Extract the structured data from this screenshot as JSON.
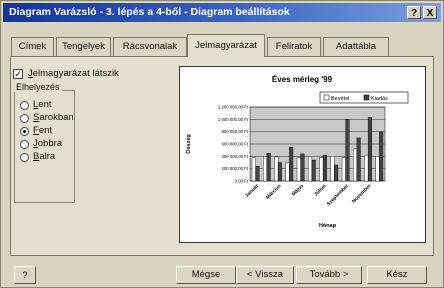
{
  "window": {
    "title": "Diagram Varázsló - 3. lépés a 4-ből - Diagram beállítások",
    "help_glyph": "?",
    "close_glyph": "X"
  },
  "tabs": [
    {
      "label": "Címek",
      "active": false
    },
    {
      "label": "Tengelyek",
      "active": false
    },
    {
      "label": "Rácsvonalak",
      "active": false
    },
    {
      "label": "Jelmagyarázat",
      "active": true
    },
    {
      "label": "Feliratok",
      "active": false
    },
    {
      "label": "Adattábla",
      "active": false
    }
  ],
  "legend_options": {
    "show_legend_label": "Jelmagyarázat látszik",
    "show_legend_checked": true,
    "placement_group_title": "Elhelyezés",
    "placements": [
      {
        "label": "Lent",
        "selected": false
      },
      {
        "label": "Sarokban",
        "selected": false
      },
      {
        "label": "Fent",
        "selected": true
      },
      {
        "label": "Jobbra",
        "selected": false
      },
      {
        "label": "Balra",
        "selected": false
      }
    ]
  },
  "chart_data": {
    "type": "bar",
    "title": "Éves mérleg '99",
    "xlabel": "Hónap",
    "ylabel": "Összeg",
    "legend_position": "top-right",
    "ylim": [
      0,
      1200000
    ],
    "ytick_labels": [
      "1 200 000,00 Ft",
      "1 000 000,00 Ft",
      "800 000,00 Ft",
      "600 000,00 Ft",
      "400 000,00 Ft",
      "200 000,00 Ft",
      "0,00 Ft"
    ],
    "categories": [
      "Január",
      "",
      "Március",
      "",
      "Május",
      "",
      "Július",
      "",
      "Szeptember",
      "",
      "November",
      ""
    ],
    "series": [
      {
        "name": "Bevétel",
        "color": "#ffffff",
        "values": [
          380000,
          400000,
          390000,
          300000,
          380000,
          400000,
          380000,
          400000,
          380000,
          520000,
          420000,
          400000
        ]
      },
      {
        "name": "Kiadás",
        "color": "#444444",
        "values": [
          240000,
          450000,
          300000,
          550000,
          440000,
          340000,
          420000,
          260000,
          1000000,
          700000,
          1030000,
          800000
        ]
      }
    ]
  },
  "buttons": {
    "help": "?",
    "cancel": "Mégse",
    "back": "< Vissza",
    "next": "Tovább >",
    "finish": "Kész"
  },
  "colors": {
    "title_bar": "#15339a",
    "dialog_bg": "#d9d3c0"
  }
}
